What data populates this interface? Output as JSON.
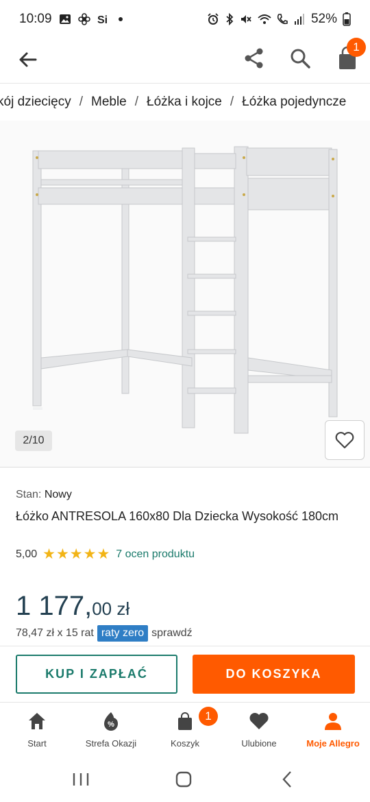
{
  "status_bar": {
    "time": "10:09",
    "battery": "52%"
  },
  "app_bar": {
    "cart_count": "1"
  },
  "breadcrumb": [
    "kój dziecięcy",
    "Meble",
    "Łóżka i kojce",
    "Łóżka pojedyncze"
  ],
  "gallery": {
    "counter": "2/10"
  },
  "product": {
    "condition_label": "Stan:",
    "condition_value": "Nowy",
    "title": "Łóżko ANTRESOLA 160x80 Dla Dziecka Wysokość 180cm",
    "rating_score": "5,00",
    "stars": "★★★★★",
    "rating_count": "7 ocen produktu",
    "price_main": "1 177,",
    "price_fraction": "00 zł",
    "installment_text": "78,47 zł x 15 rat",
    "installment_tag": "raty zero",
    "installment_link": "sprawdź"
  },
  "actions": {
    "buy_now": "KUP I ZAPŁAĆ",
    "add_to_cart": "DO KOSZYKA"
  },
  "bottom_nav": {
    "items": [
      {
        "label": "Start",
        "icon": "home-icon"
      },
      {
        "label": "Strefa Okazji",
        "icon": "discount-icon"
      },
      {
        "label": "Koszyk",
        "icon": "cart-icon"
      },
      {
        "label": "Ulubione",
        "icon": "heart-icon"
      },
      {
        "label": "Moje Allegro",
        "icon": "user-icon"
      }
    ],
    "cart_badge": "1"
  },
  "colors": {
    "accent": "#ff5a00",
    "teal": "#1a7a6b",
    "price": "#234051",
    "raty_tag": "#2f7ec5"
  }
}
